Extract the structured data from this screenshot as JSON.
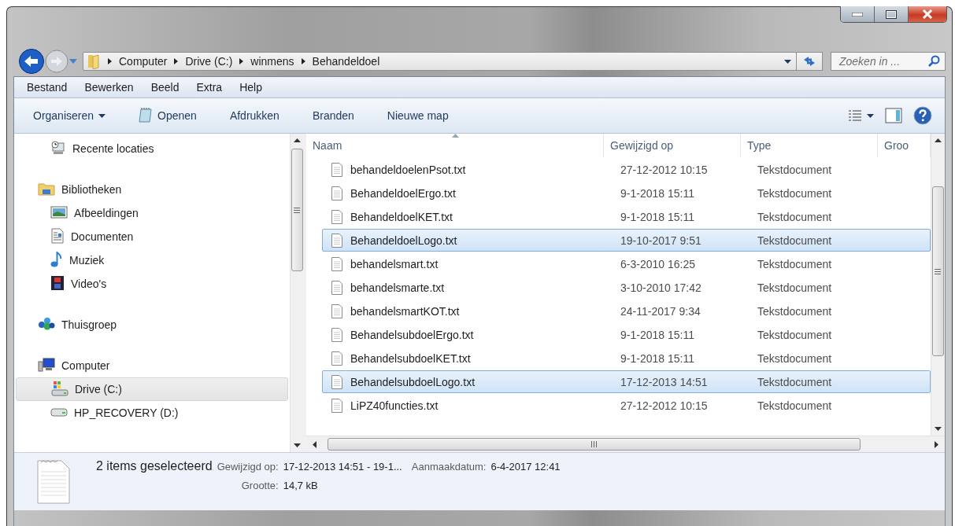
{
  "address_bar": {
    "breadcrumbs": [
      "Computer",
      "Drive (C:)",
      "winmens",
      "Behandeldoel"
    ]
  },
  "search": {
    "placeholder": "Zoeken in ..."
  },
  "menu": [
    "Bestand",
    "Bewerken",
    "Beeld",
    "Extra",
    "Help"
  ],
  "toolbar": [
    {
      "label": "Organiseren",
      "kind": "dropdown"
    },
    {
      "label": "Openen",
      "kind": "icon"
    },
    {
      "label": "Afdrukken",
      "kind": "plain"
    },
    {
      "label": "Branden",
      "kind": "plain"
    },
    {
      "label": "Nieuwe map",
      "kind": "plain"
    }
  ],
  "sidebar": {
    "groups": [
      {
        "items": [
          {
            "label": "Recente locaties",
            "kind": "recent",
            "selected": false
          }
        ]
      },
      {
        "label": "Bibliotheken",
        "kind": "library",
        "items": [
          {
            "label": "Afbeeldingen",
            "kind": "pictures",
            "selected": false
          },
          {
            "label": "Documenten",
            "kind": "documents",
            "selected": false
          },
          {
            "label": "Muziek",
            "kind": "music",
            "selected": false
          },
          {
            "label": "Video's",
            "kind": "videos",
            "selected": false
          }
        ]
      },
      {
        "label": "Thuisgroep",
        "kind": "homegroup"
      },
      {
        "label": "Computer",
        "kind": "computer",
        "items": [
          {
            "label": "Drive (C:)",
            "kind": "system-drive",
            "selected": true
          },
          {
            "label": "HP_RECOVERY (D:)",
            "kind": "drive",
            "selected": false
          }
        ]
      }
    ]
  },
  "file_list": {
    "columns": [
      {
        "label": "Naam",
        "sorted": true
      },
      {
        "label": "Gewijzigd op",
        "sorted": false
      },
      {
        "label": "Type",
        "sorted": false
      },
      {
        "label": "Groo",
        "sorted": false
      }
    ],
    "rows": [
      {
        "name": "behandeldoelenPsot.txt",
        "modified": "27-12-2012 10:15",
        "type": "Tekstdocument",
        "selected": false
      },
      {
        "name": "BehandeldoelErgo.txt",
        "modified": "9-1-2018 15:11",
        "type": "Tekstdocument",
        "selected": false
      },
      {
        "name": "BehandeldoelKET.txt",
        "modified": "9-1-2018 15:11",
        "type": "Tekstdocument",
        "selected": false
      },
      {
        "name": "BehandeldoelLogo.txt",
        "modified": "19-10-2017 9:51",
        "type": "Tekstdocument",
        "selected": true
      },
      {
        "name": "behandelsmart.txt",
        "modified": "6-3-2010 16:25",
        "type": "Tekstdocument",
        "selected": false
      },
      {
        "name": "behandelsmarte.txt",
        "modified": "3-10-2010 17:42",
        "type": "Tekstdocument",
        "selected": false
      },
      {
        "name": "behandelsmartKOT.txt",
        "modified": "24-11-2017 9:34",
        "type": "Tekstdocument",
        "selected": false
      },
      {
        "name": "BehandelsubdoelErgo.txt",
        "modified": "9-1-2018 15:11",
        "type": "Tekstdocument",
        "selected": false
      },
      {
        "name": "BehandelsubdoelKET.txt",
        "modified": "9-1-2018 15:11",
        "type": "Tekstdocument",
        "selected": false
      },
      {
        "name": "BehandelsubdoelLogo.txt",
        "modified": "17-12-2013 14:51",
        "type": "Tekstdocument",
        "selected": true
      },
      {
        "name": "LiPZ40functies.txt",
        "modified": "27-12-2012 10:15",
        "type": "Tekstdocument",
        "selected": false
      }
    ]
  },
  "details": {
    "summary": "2 items geselecteerd",
    "fields": [
      {
        "label": "Gewijzigd op:",
        "value": "17-12-2013 14:51 - 19-1..."
      },
      {
        "label": "Aanmaakdatum:",
        "value": "6-4-2017 12:41"
      },
      {
        "label": "Grootte:",
        "value": "14,7 kB"
      }
    ]
  }
}
